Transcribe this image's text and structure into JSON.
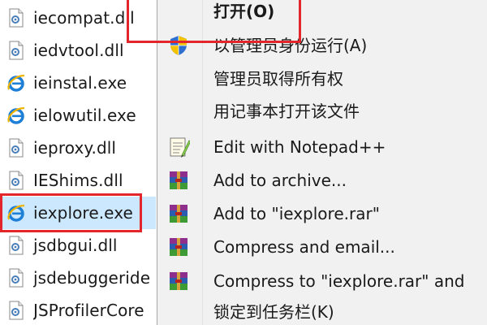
{
  "file_list": {
    "items": [
      {
        "name": "iecompat.dll",
        "icon": "dll-file-icon"
      },
      {
        "name": "iedvtool.dll",
        "icon": "dll-file-icon"
      },
      {
        "name": "ieinstal.exe",
        "icon": "internet-explorer-icon"
      },
      {
        "name": "ielowutil.exe",
        "icon": "internet-explorer-icon"
      },
      {
        "name": "ieproxy.dll",
        "icon": "dll-file-icon"
      },
      {
        "name": "IEShims.dll",
        "icon": "dll-file-icon"
      },
      {
        "name": "iexplore.exe",
        "icon": "internet-explorer-icon",
        "selected": true
      },
      {
        "name": "jsdbgui.dll",
        "icon": "dll-file-icon"
      },
      {
        "name": "jsdebuggeride",
        "icon": "dll-file-icon"
      },
      {
        "name": "JSProfilerCore",
        "icon": "dll-file-icon"
      }
    ]
  },
  "context_menu": {
    "items": [
      {
        "label": "打开(O)",
        "icon": "none",
        "bold": true
      },
      {
        "label": "以管理员身份运行(A)",
        "icon": "uac-shield-icon"
      },
      {
        "label": "管理员取得所有权",
        "icon": "none"
      },
      {
        "label": "用记事本打开该文件",
        "icon": "none"
      },
      {
        "label": "Edit with Notepad++",
        "icon": "notepad-plus-plus-icon"
      },
      {
        "label": "Add to archive...",
        "icon": "winrar-icon"
      },
      {
        "label": "Add to \"iexplore.rar\"",
        "icon": "winrar-icon"
      },
      {
        "label": "Compress and email...",
        "icon": "winrar-icon"
      },
      {
        "label": "Compress to \"iexplore.rar\" and",
        "icon": "winrar-icon"
      },
      {
        "label": "锁定到任务栏(K)",
        "icon": "none"
      }
    ]
  },
  "colors": {
    "highlight_border": "#e3262b",
    "selection_background": "#cce8ff",
    "menu_background": "#f1f1f1"
  }
}
